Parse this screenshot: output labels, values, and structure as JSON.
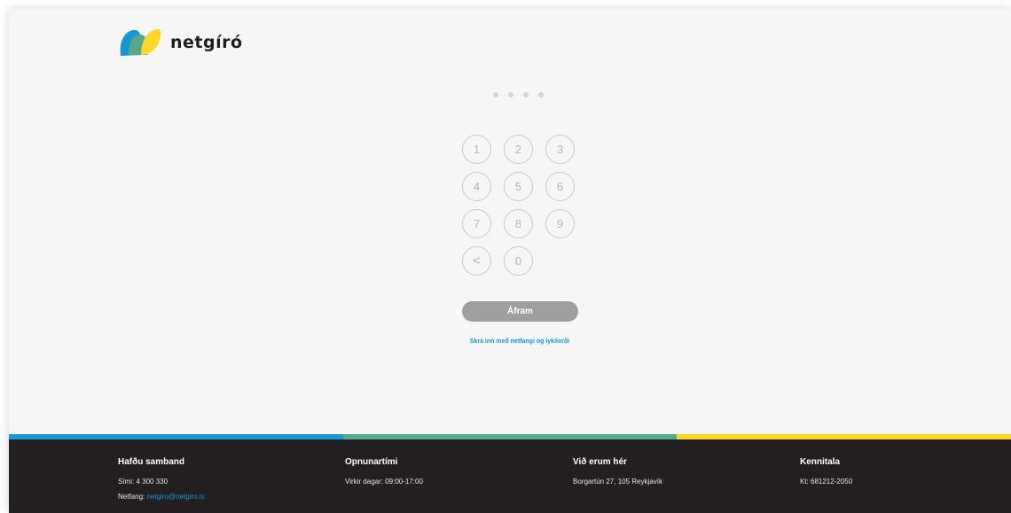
{
  "brand": {
    "name": "netgíró",
    "colors": {
      "blue": "#1597d6",
      "green": "#56a88a",
      "yellow": "#fcd729"
    }
  },
  "pin": {
    "length": 4
  },
  "keypad": {
    "keys": [
      "1",
      "2",
      "3",
      "4",
      "5",
      "6",
      "7",
      "8",
      "9",
      "<",
      "0"
    ]
  },
  "submit_label": "Áfram",
  "alt_login_label": "Skrá inn með netfangi og lykilorði",
  "footer": {
    "contact": {
      "title": "Hafðu samband",
      "phone": "Sími: 4 300 330",
      "email_label": "Netfang: ",
      "email": "netgiro@netgiro.is"
    },
    "hours": {
      "title": "Opnunartími",
      "text": "Virkir dagar: 09:00-17:00"
    },
    "location": {
      "title": "Við erum hér",
      "text": "Borgartún 27, 105 Reykjavík"
    },
    "kennitala": {
      "title": "Kennitala",
      "text": "Kt: 681212-2050"
    }
  }
}
